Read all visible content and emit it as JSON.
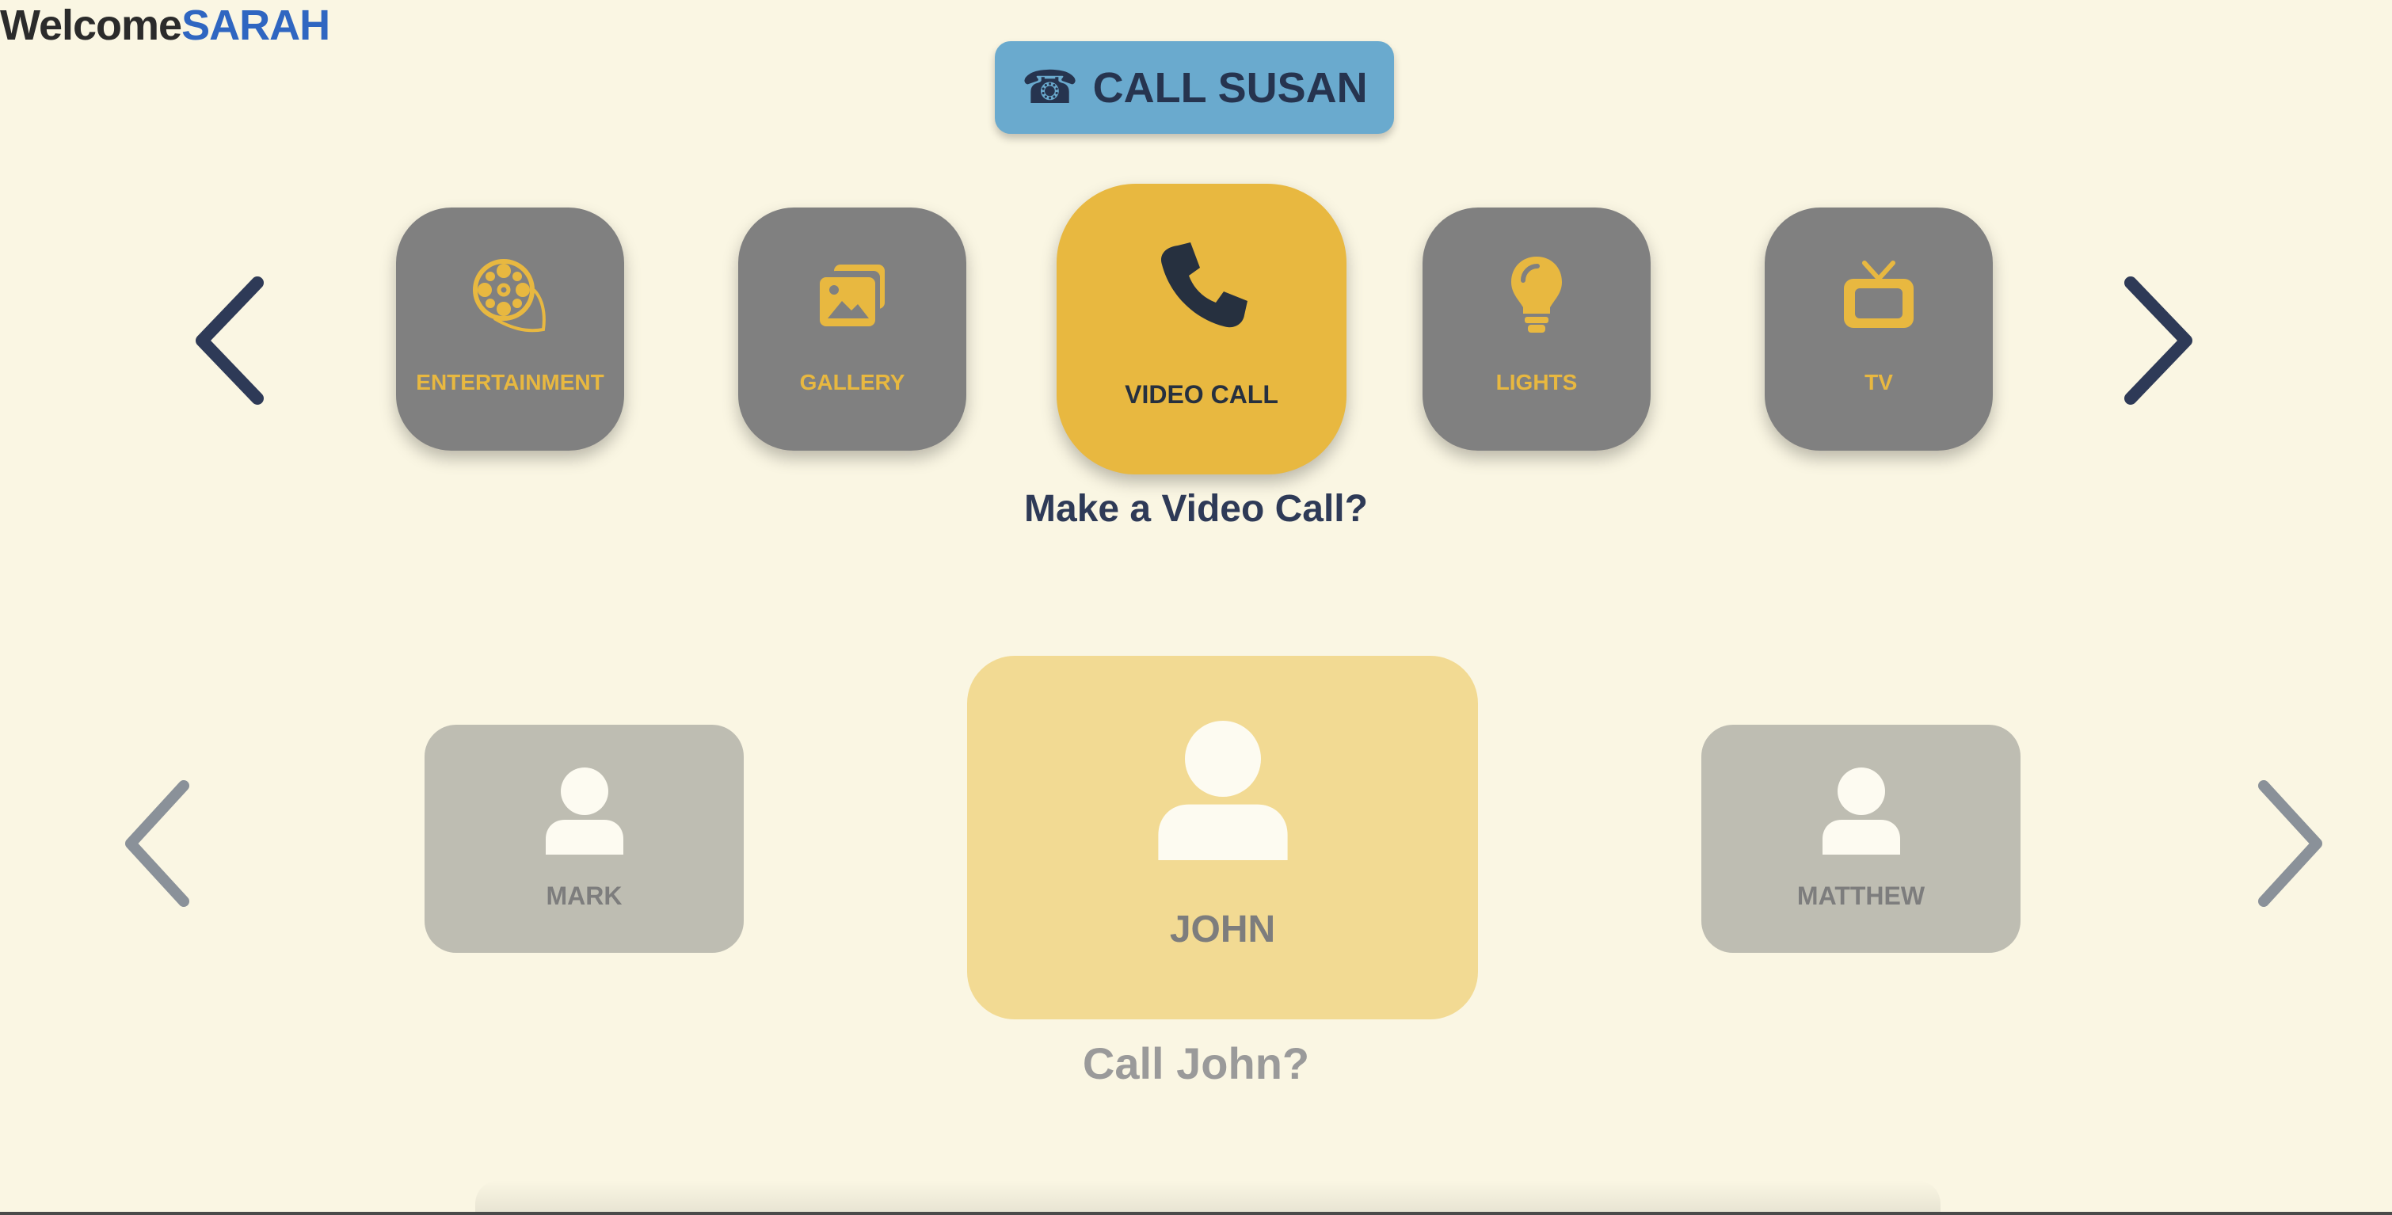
{
  "header": {
    "welcome_text": "Welcome",
    "user_name": "SARAH"
  },
  "top_call": {
    "label": "CALL SUSAN",
    "icon": "telephone-icon"
  },
  "menu": {
    "items": [
      {
        "label": "ENTERTAINMENT",
        "icon": "film-reel-icon",
        "selected": false
      },
      {
        "label": "GALLERY",
        "icon": "images-icon",
        "selected": false
      },
      {
        "label": "VIDEO CALL",
        "icon": "phone-icon",
        "selected": true
      },
      {
        "label": "LIGHTS",
        "icon": "lightbulb-icon",
        "selected": false
      },
      {
        "label": "TV",
        "icon": "tv-icon",
        "selected": false
      }
    ],
    "prompt": "Make a Video Call?"
  },
  "contacts": {
    "items": [
      {
        "name": "MARK",
        "icon": "person-icon",
        "selected": false
      },
      {
        "name": "JOHN",
        "icon": "person-icon",
        "selected": true
      },
      {
        "name": "MATTHEW",
        "icon": "person-icon",
        "selected": false
      }
    ],
    "prompt": "Call John?"
  },
  "colors": {
    "background": "#faf6e3",
    "accent_yellow": "#e8b840",
    "tile_gray": "#808080",
    "navy": "#2e3a57",
    "call_button_blue": "#6aaace",
    "name_blue": "#2f66c1"
  }
}
